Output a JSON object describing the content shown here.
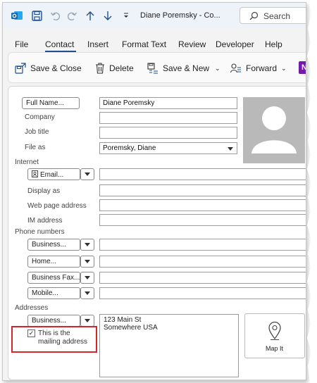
{
  "titlebar": {
    "title": "Diane Poremsky - Co...",
    "search_label": "Search",
    "qat_icons": [
      "outlook-icon",
      "save-icon",
      "undo-icon",
      "redo-icon",
      "up-arrow-icon",
      "down-arrow-icon",
      "customize-icon"
    ]
  },
  "menu": {
    "items": [
      "File",
      "Contact",
      "Insert",
      "Format Text",
      "Review",
      "Developer",
      "Help"
    ],
    "active": "Contact"
  },
  "ribbon": {
    "save_close": "Save & Close",
    "delete": "Delete",
    "save_new": "Save & New",
    "forward": "Forward"
  },
  "form": {
    "full_name_button": "Full Name...",
    "full_name_value": "Diane Poremsky",
    "company_label": "Company",
    "company_value": "",
    "job_title_label": "Job title",
    "job_title_value": "",
    "file_as_label": "File as",
    "file_as_value": "Poremsky, Diane",
    "internet_section": "Internet",
    "email_button": "Email...",
    "email_value": "",
    "display_as_label": "Display as",
    "web_page_label": "Web page address",
    "im_address_label": "IM address",
    "phone_section": "Phone numbers",
    "phones": [
      {
        "label": "Business...",
        "value": ""
      },
      {
        "label": "Home...",
        "value": ""
      },
      {
        "label": "Business Fax...",
        "value": ""
      },
      {
        "label": "Mobile...",
        "value": ""
      }
    ],
    "addresses_section": "Addresses",
    "address_type": "Business...",
    "address_line1": "123 Main St",
    "address_line2": "Somewhere USA",
    "mailing_line1": "This is the",
    "mailing_line2": "mailing address",
    "mailing_checked": true,
    "map_it": "Map It"
  },
  "colors": {
    "accent": "#1d4f91",
    "highlight": "#d4242e",
    "outlook_blue": "#0f6cbd"
  }
}
